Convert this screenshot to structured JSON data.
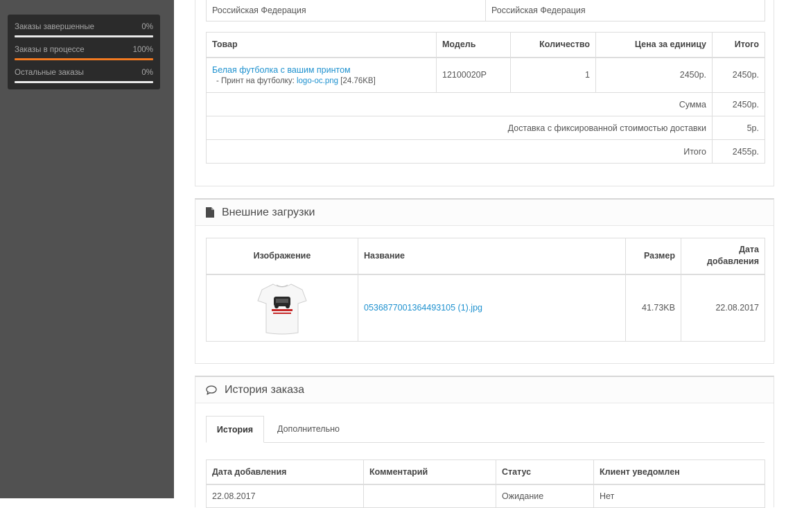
{
  "sidebar": {
    "stats": [
      {
        "label": "Заказы завершенные",
        "value": "0%",
        "fraction": 0
      },
      {
        "label": "Заказы в процессе",
        "value": "100%",
        "fraction": 1
      },
      {
        "label": "Остальные заказы",
        "value": "0%",
        "fraction": 0
      }
    ]
  },
  "addresses": {
    "left_country": "Российская Федерация",
    "right_country": "Российская Федерация"
  },
  "products": {
    "headers": {
      "product": "Товар",
      "model": "Модель",
      "quantity": "Количество",
      "unit_price": "Цена за единицу",
      "total": "Итого"
    },
    "items": [
      {
        "name": "Белая футболка с вашим принтом",
        "option_label": "- Принт на футболку:",
        "option_file": "logo-oc.png",
        "option_size": "[24.76KB]",
        "model": "12100020P",
        "quantity": "1",
        "unit_price": "2450р.",
        "total": "2450р."
      }
    ],
    "totals": [
      {
        "label": "Сумма",
        "value": "2450р."
      },
      {
        "label": "Доставка с фиксированной стоимостью доставки",
        "value": "5р."
      },
      {
        "label": "Итого",
        "value": "2455р."
      }
    ]
  },
  "uploads": {
    "title": "Внешние загрузки",
    "headers": {
      "image": "Изображение",
      "name": "Название",
      "size": "Размер",
      "date_line1": "Дата",
      "date_line2": "добавления"
    },
    "rows": [
      {
        "name": "0536877001364493105 (1).jpg",
        "size": "41.73KB",
        "date": "22.08.2017"
      }
    ]
  },
  "history": {
    "title": "История заказа",
    "tabs": [
      "История",
      "Дополнительно"
    ],
    "headers": {
      "date": "Дата добавления",
      "comment": "Комментарий",
      "status": "Статус",
      "notified": "Клиент уведомлен"
    },
    "rows": [
      {
        "date": "22.08.2017",
        "comment": "",
        "status": "Ожидание",
        "notified": "Нет"
      }
    ]
  },
  "colors": {
    "accent": "#f37a20",
    "link": "#1e91cf",
    "sidebar": "#515151"
  },
  "icons": {
    "uploads": "file-icon",
    "history": "comment-icon"
  }
}
